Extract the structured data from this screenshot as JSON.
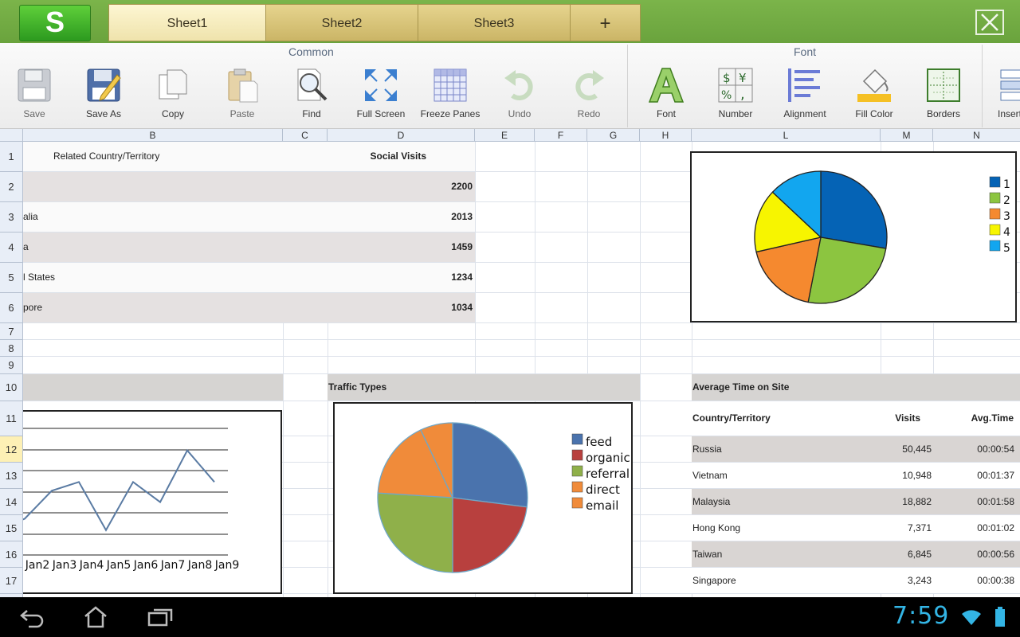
{
  "app": {
    "logo_letter": "S",
    "tabs": [
      {
        "label": "Sheet1",
        "active": true
      },
      {
        "label": "Sheet2",
        "active": false
      },
      {
        "label": "Sheet3",
        "active": false
      },
      {
        "label": "+",
        "active": false
      }
    ]
  },
  "ribbon": {
    "groups": [
      "Common",
      "Font"
    ],
    "tools": [
      {
        "label": "Save",
        "icon": "floppy-disk-icon"
      },
      {
        "label": "Save As",
        "icon": "floppy-pencil-icon"
      },
      {
        "label": "Copy",
        "icon": "copy-icon"
      },
      {
        "label": "Paste",
        "icon": "clipboard-icon"
      },
      {
        "label": "Find",
        "icon": "magnifier-icon"
      },
      {
        "label": "Full Screen",
        "icon": "expand-arrows-icon"
      },
      {
        "label": "Freeze Panes",
        "icon": "grid-icon"
      },
      {
        "label": "Undo",
        "icon": "undo-arrow-icon"
      },
      {
        "label": "Redo",
        "icon": "redo-arrow-icon"
      },
      {
        "label": "Font",
        "icon": "letter-a-icon"
      },
      {
        "label": "Number",
        "icon": "currency-symbols-icon"
      },
      {
        "label": "Alignment",
        "icon": "align-lines-icon"
      },
      {
        "label": "Fill Color",
        "icon": "paint-bucket-icon"
      },
      {
        "label": "Borders",
        "icon": "borders-icon"
      },
      {
        "label": "Insert",
        "icon": "insert-rows-icon"
      }
    ]
  },
  "grid": {
    "columns": [
      "B",
      "C",
      "D",
      "E",
      "F",
      "G",
      "H",
      "L",
      "M",
      "N"
    ],
    "rows": [
      "1",
      "2",
      "3",
      "4",
      "5",
      "6",
      "7",
      "8",
      "9",
      "10",
      "11",
      "12",
      "13",
      "14",
      "15",
      "16",
      "17"
    ]
  },
  "table_top": {
    "header_country": "Related Country/Territory",
    "header_visits": "Social Visits",
    "rows": [
      {
        "country": "",
        "visits": "2200"
      },
      {
        "country": "alia",
        "visits": "2013"
      },
      {
        "country": "a",
        "visits": "1459"
      },
      {
        "country": "l States",
        "visits": "1234"
      },
      {
        "country": "pore",
        "visits": "1034"
      }
    ]
  },
  "traffic_title": "Traffic Types",
  "avg_table": {
    "title": "Average Time on Site",
    "headers": [
      "Country/Territory",
      "Visits",
      "Avg.Time"
    ],
    "rows": [
      [
        "Russia",
        "50,445",
        "00:00:54"
      ],
      [
        "Vietnam",
        "10,948",
        "00:01:37"
      ],
      [
        "Malaysia",
        "18,882",
        "00:01:58"
      ],
      [
        "Hong Kong",
        "7,371",
        "00:01:02"
      ],
      [
        "Taiwan",
        "6,845",
        "00:00:56"
      ],
      [
        "Singapore",
        "3,243",
        "00:00:38"
      ]
    ]
  },
  "chart_data": [
    {
      "type": "pie",
      "categories": [
        "1",
        "2",
        "3",
        "4",
        "5"
      ],
      "values": [
        2200,
        2013,
        1459,
        1234,
        1034
      ],
      "colors": [
        "#0563b5",
        "#8cc540",
        "#f5892f",
        "#f7f500",
        "#12a6ef"
      ],
      "legend": "right"
    },
    {
      "type": "pie",
      "categories": [
        "feed",
        "organic",
        "referral",
        "direct",
        "email"
      ],
      "values": [
        27,
        23,
        26,
        17,
        7
      ],
      "colors": [
        "#4a73ad",
        "#b8403e",
        "#8fb04a",
        "#f08b3a",
        "#f08b3a"
      ],
      "legend": "right"
    },
    {
      "type": "line",
      "categories": [
        "Jan2",
        "Jan3",
        "Jan4",
        "Jan5",
        "Jan6",
        "Jan7",
        "Jan8",
        "Jan9"
      ],
      "values": [
        5,
        37,
        47,
        -8,
        47,
        24,
        83,
        47
      ],
      "color": "#5a7ba3",
      "grid": true
    }
  ],
  "status": {
    "time": "7:59"
  }
}
